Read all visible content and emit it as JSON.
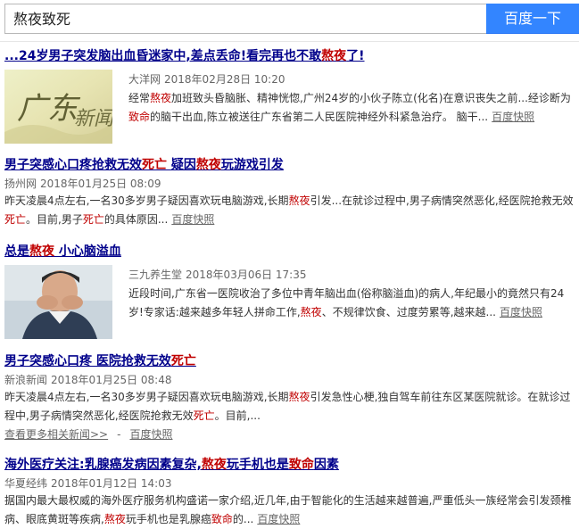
{
  "search": {
    "query": "熬夜致死",
    "button_label": "百度一下"
  },
  "results": [
    {
      "title_parts": [
        "...24岁男子突发脑出血昏迷家中,差点丢命!看完再也不敢",
        "熬夜",
        "了!"
      ],
      "source": "大洋网",
      "time": "2018年02月28日 10:20",
      "abstract_parts": [
        "经常",
        "熬夜",
        "加班致头昏脑胀、精神恍惚,广州24岁的小伙子陈立(化名)在意识丧失之前...经诊断为",
        "致命",
        "的脑干出血,陈立被送往广东省第二人民医院神经外科紧急治疗。 脑干..."
      ],
      "cache_label": "百度快照",
      "thumb_text": "广东新闻"
    },
    {
      "title_parts": [
        "男子突感心口疼抢救无效",
        "死亡",
        " 疑因",
        "熬夜",
        "玩游戏引发"
      ],
      "source": "扬州网",
      "time": "2018年01月25日 08:09",
      "abstract_parts": [
        "昨天凌晨4点左右,一名30多岁男子疑因喜欢玩电脑游戏,长期",
        "熬夜",
        "引发...在就诊过程中,男子病情突然恶化,经医院抢救无效",
        "死亡",
        "。目前,男子",
        "死亡",
        "的具体原因..."
      ],
      "cache_label": "百度快照"
    },
    {
      "title_parts": [
        "总是",
        "熬夜",
        " 小心脑溢血"
      ],
      "source": "三九养生堂",
      "time": "2018年03月06日 17:35",
      "abstract_parts": [
        "近段时间,广东省一医院收治了多位中青年脑出血(俗称脑溢血)的病人,年纪最小的竟然只有24岁!专家话:越来越多年轻人拼命工作,",
        "熬夜",
        "、不规律饮食、过度劳累等,越来越..."
      ],
      "cache_label": "百度快照"
    },
    {
      "title_parts": [
        "男子突感心口疼 医院抢救无效",
        "死亡"
      ],
      "source": "新浪新闻",
      "time": "2018年01月25日 08:48",
      "abstract_parts": [
        "昨天凌晨4点左右,一名30多岁男子疑因喜欢玩电脑游戏,长期",
        "熬夜",
        "引发急性心梗,独自驾车前往东区某医院就诊。在就诊过程中,男子病情突然恶化,经医院抢救无效",
        "死亡",
        "。目前,..."
      ],
      "more_label": "查看更多相关新闻>>",
      "cache_label": "百度快照"
    },
    {
      "title_parts": [
        "海外医疗关注:乳腺癌发病因素复杂,",
        "熬夜",
        "玩手机也是",
        "致命",
        "因素"
      ],
      "source": "华夏经纬",
      "time": "2018年01月12日 14:03",
      "abstract_parts": [
        "据国内最大最权威的海外医疗服务机构盛诺一家介绍,近几年,由于智能化的生活越来越普遍,严重低头一族经常会引发颈椎病、眼底黄斑等疾病,",
        "熬夜",
        "玩手机也是乳腺癌",
        "致命",
        "的..."
      ],
      "cache_label": "百度快照"
    }
  ],
  "colors": {
    "title": "#00008b",
    "highlight": "#c00000",
    "button": "#3385ff"
  }
}
